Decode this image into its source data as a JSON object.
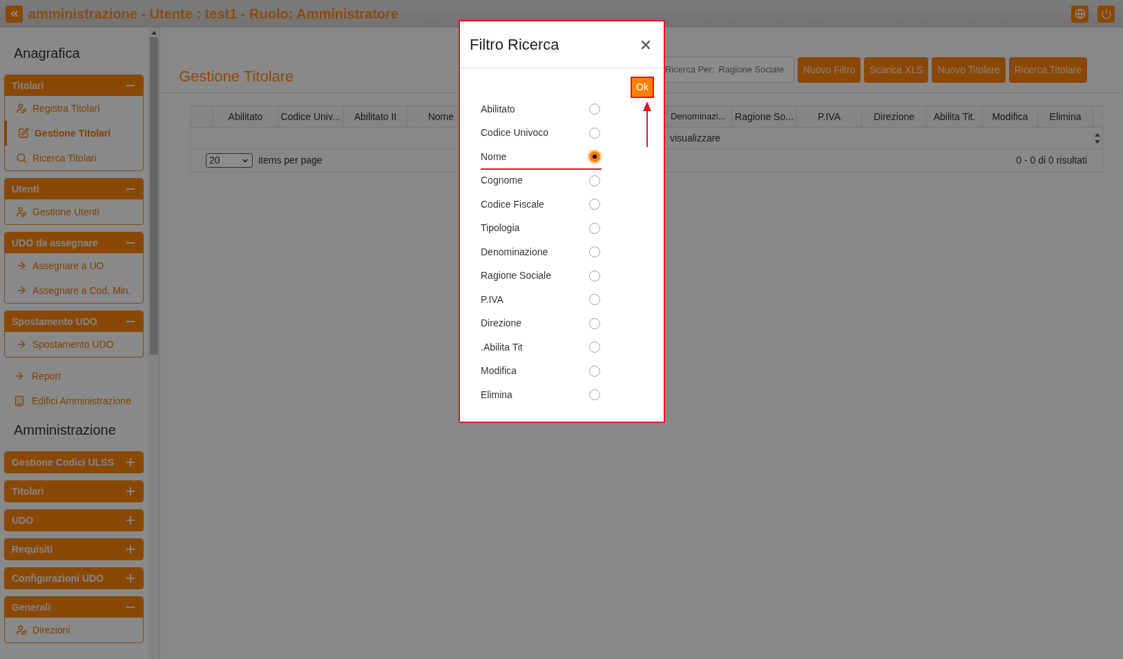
{
  "header": {
    "title": "amministrazione - Utente : test1 - Ruolo: Amministratore"
  },
  "sidebar": {
    "groups": [
      {
        "heading": "Anagrafica",
        "sections": [
          {
            "kind": "panel",
            "title": "Titolari",
            "expanded": true,
            "items": [
              {
                "label": "Registra Titolari",
                "kind": "user-edit",
                "selected": false
              },
              {
                "label": "Gestione Titolari",
                "kind": "edit",
                "selected": true
              },
              {
                "label": "Ricerca Titolari",
                "kind": "search",
                "selected": false
              }
            ]
          },
          {
            "kind": "panel",
            "title": "Utenti",
            "expanded": true,
            "items": [
              {
                "label": "Gestione Utenti",
                "kind": "user-edit",
                "selected": false
              }
            ]
          },
          {
            "kind": "panel",
            "title": "UDO da assegnare",
            "expanded": true,
            "items": [
              {
                "label": "Assegnare a UO",
                "kind": "arrow",
                "selected": false
              },
              {
                "label": "Assegnare a Cod. Min.",
                "kind": "arrow",
                "selected": false
              }
            ]
          },
          {
            "kind": "panel",
            "title": "Spostamento UDO",
            "expanded": true,
            "items": [
              {
                "label": "Spostamento UDO",
                "kind": "arrow",
                "selected": false
              }
            ]
          },
          {
            "kind": "arrow-link",
            "label": "Report"
          },
          {
            "kind": "building-link",
            "label": "Edifici Amministrazione"
          }
        ]
      },
      {
        "heading": "Amministrazione",
        "sections": [
          {
            "kind": "panel",
            "title": "Gestione Codici ULSS",
            "expanded": false
          },
          {
            "kind": "panel",
            "title": "Titolari",
            "expanded": false
          },
          {
            "kind": "panel",
            "title": "UDO",
            "expanded": false
          },
          {
            "kind": "panel",
            "title": "Requisiti",
            "expanded": false
          },
          {
            "kind": "panel",
            "title": "Configurazioni UDO",
            "expanded": false
          },
          {
            "kind": "panel",
            "title": "Generali",
            "expanded": true,
            "items": [
              {
                "label": "Direzioni",
                "kind": "user-edit",
                "selected": false
              }
            ]
          }
        ]
      }
    ]
  },
  "page": {
    "title": "Gestione Titolare",
    "search": {
      "label": "Ricerca Per:",
      "value": "Ragione Sociale"
    },
    "buttons": [
      "Nuovo Filtro",
      "Scarica XLS",
      "Nuovo Titolare",
      "Ricerca Titolare"
    ],
    "table": {
      "columns_left": [
        "Abilitato",
        "Codice Univ...",
        "Abilitato II",
        "Nome"
      ],
      "columns_right": [
        "Denominazi...",
        "Ragione So...",
        "P.IVA",
        "Direzione",
        "Abilita Tit.",
        "Modifica",
        "Elimina"
      ],
      "empty_message": "visualizzare",
      "page_size": "20",
      "page_size_label": "items per page",
      "summary": "0 - 0 di 0 risultati"
    }
  },
  "modal": {
    "title": "Filtro Ricerca",
    "ok_button": {
      "label": "Ok",
      "highlighted": true
    },
    "options": [
      {
        "label": "Abilitato",
        "selected": false,
        "highlighted": false
      },
      {
        "label": "Codice Univoco",
        "selected": false,
        "highlighted": false
      },
      {
        "label": "Nome",
        "selected": true,
        "highlighted": true
      },
      {
        "label": "Cognome",
        "selected": false,
        "highlighted": false
      },
      {
        "label": "Codice Fiscale",
        "selected": false,
        "highlighted": false
      },
      {
        "label": "Tipologia",
        "selected": false,
        "highlighted": false
      },
      {
        "label": "Denominazione",
        "selected": false,
        "highlighted": false
      },
      {
        "label": "Ragione Sociale",
        "selected": false,
        "highlighted": false
      },
      {
        "label": "P.IVA",
        "selected": false,
        "highlighted": false
      },
      {
        "label": "Direzione",
        "selected": false,
        "highlighted": false
      },
      {
        "label": ".Abilita Tit",
        "selected": false,
        "highlighted": false
      },
      {
        "label": "Modifica",
        "selected": false,
        "highlighted": false
      },
      {
        "label": "Elimina",
        "selected": false,
        "highlighted": false
      }
    ]
  }
}
